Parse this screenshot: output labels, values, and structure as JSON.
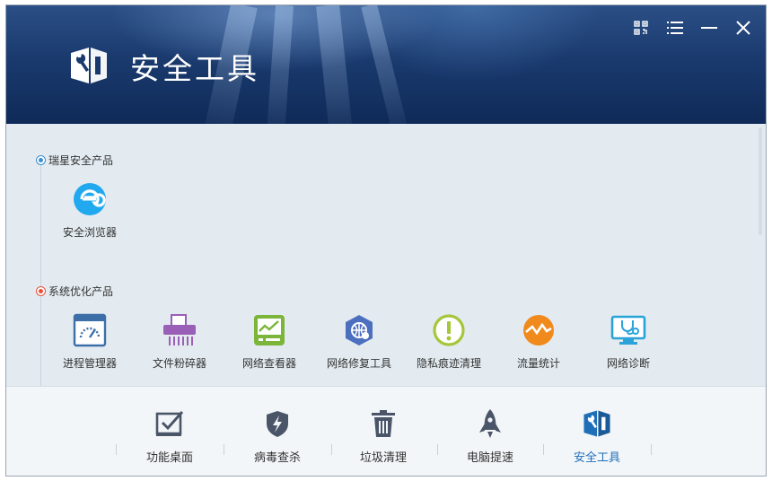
{
  "header": {
    "title": "安全工具",
    "buttons": [
      {
        "name": "qr-code-icon"
      },
      {
        "name": "menu-icon"
      },
      {
        "name": "minimize-icon"
      },
      {
        "name": "close-icon"
      }
    ]
  },
  "sections": [
    {
      "title": "瑞星安全产品",
      "dot_color": "#3a8fd1",
      "items": [
        {
          "label": "安全浏览器",
          "icon": "browser-e-icon",
          "color": "#21a9ef"
        }
      ]
    },
    {
      "title": "系统优化产品",
      "dot_color": "#e5533b",
      "items": [
        {
          "label": "进程管理器",
          "icon": "process-dashboard-icon",
          "color": "#3c6fa8"
        },
        {
          "label": "文件粉碎器",
          "icon": "shredder-icon",
          "color": "#9a5fb7"
        },
        {
          "label": "网络查看器",
          "icon": "network-monitor-icon",
          "color": "#7bb53a"
        },
        {
          "label": "网络修复工具",
          "icon": "network-repair-icon",
          "color": "#4d6fc0"
        },
        {
          "label": "隐私痕迹清理",
          "icon": "privacy-clean-icon",
          "color": "#a6c63a"
        },
        {
          "label": "流量统计",
          "icon": "traffic-stats-icon",
          "color": "#f08a1c"
        },
        {
          "label": "网络诊断",
          "icon": "network-diagnose-icon",
          "color": "#2aa3d8"
        }
      ]
    }
  ],
  "bottom_tabs": [
    {
      "label": "功能桌面",
      "icon": "checkbox-desk-icon"
    },
    {
      "label": "病毒查杀",
      "icon": "shield-bolt-icon"
    },
    {
      "label": "垃圾清理",
      "icon": "trash-icon"
    },
    {
      "label": "电脑提速",
      "icon": "rocket-icon"
    },
    {
      "label": "安全工具",
      "icon": "tools-icon",
      "active": true
    }
  ],
  "colors": {
    "accent": "#1f6fb8",
    "header": "#1a3a6e"
  }
}
